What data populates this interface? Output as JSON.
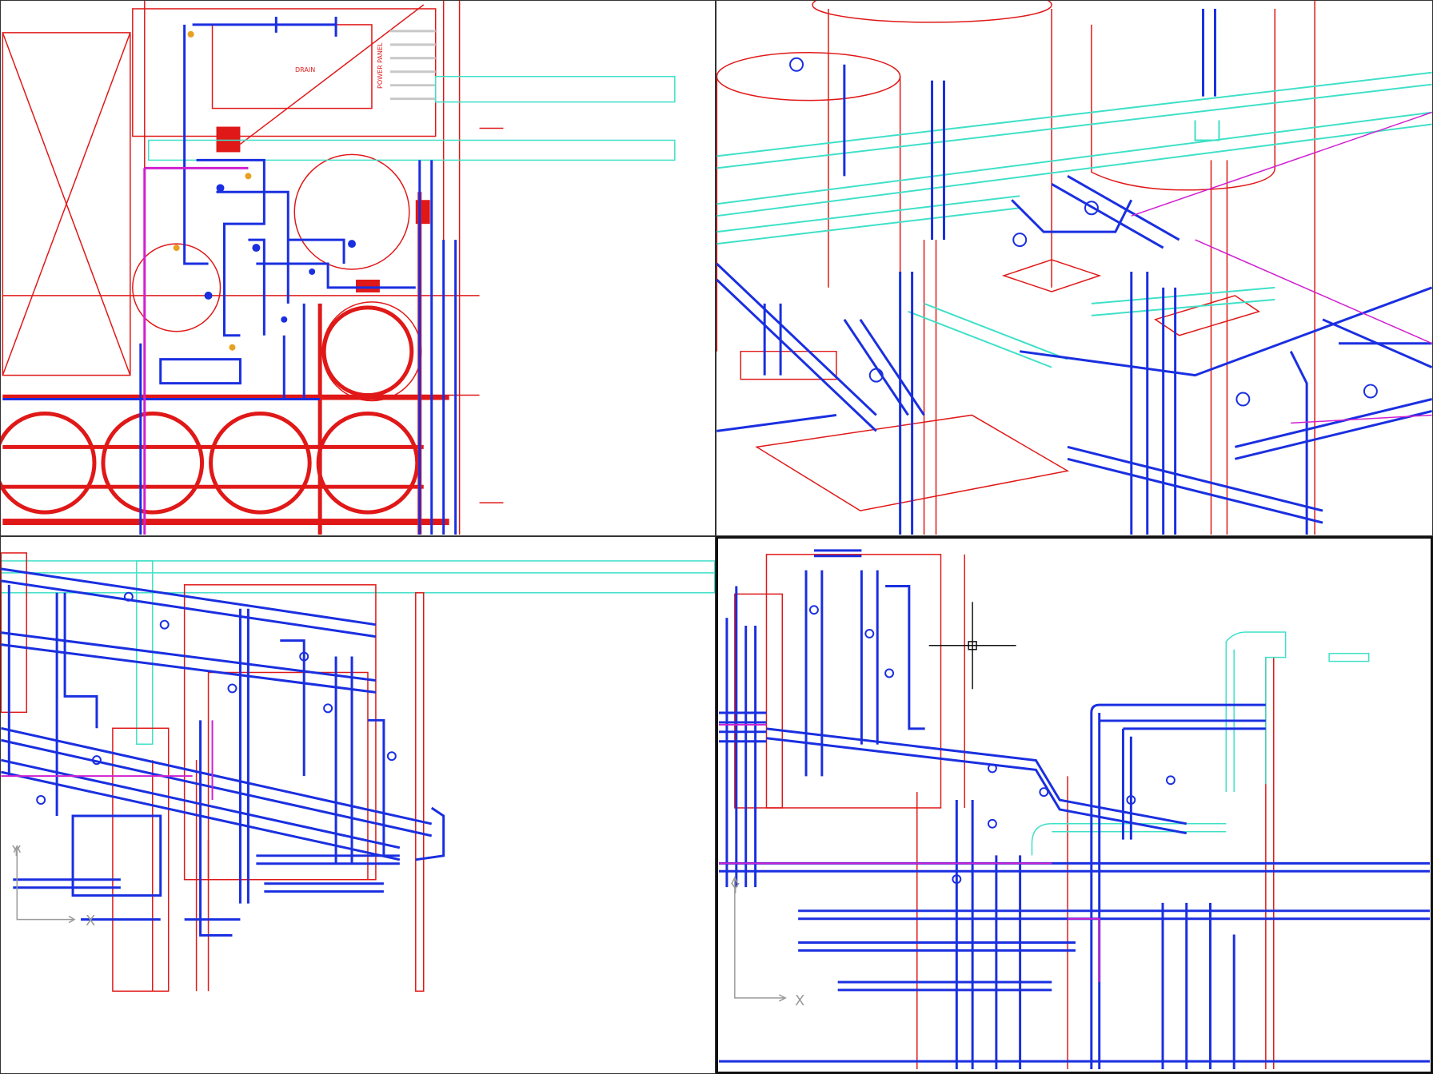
{
  "app": {
    "title": ""
  },
  "viewports": {
    "top_left": {
      "text_a": "DRAIN",
      "text_b": "POWER PANEL"
    },
    "bottom_left": {
      "ucs_x": "X",
      "ucs_y": "Y"
    },
    "bottom_right": {
      "ucs_x": "X",
      "ucs_y": "Y"
    }
  },
  "colors": {
    "red": "#e01818",
    "blue": "#1a2fe0",
    "cyan": "#3fe0c8",
    "magenta": "#d020d0",
    "grey": "#9a9a9a",
    "black": "#111111"
  }
}
